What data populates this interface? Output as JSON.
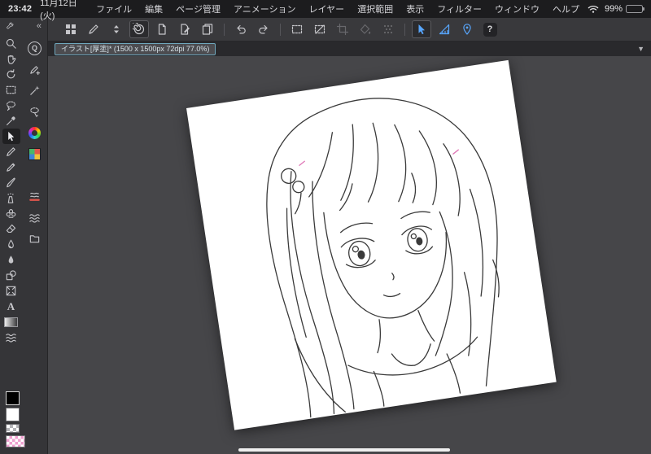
{
  "status_bar": {
    "time": "23:42",
    "date": "11月12日(火)",
    "battery_percent": "99%"
  },
  "menu_bar": {
    "items": [
      {
        "id": "file",
        "label": "ファイル"
      },
      {
        "id": "edit",
        "label": "編集"
      },
      {
        "id": "page-management",
        "label": "ページ管理"
      },
      {
        "id": "animation",
        "label": "アニメーション"
      },
      {
        "id": "layer",
        "label": "レイヤー"
      },
      {
        "id": "selection",
        "label": "選択範囲"
      },
      {
        "id": "view",
        "label": "表示"
      },
      {
        "id": "filter",
        "label": "フィルター"
      },
      {
        "id": "window",
        "label": "ウィンドウ"
      },
      {
        "id": "help",
        "label": "ヘルプ"
      }
    ]
  },
  "toolbar": {
    "items": [
      {
        "name": "workspace-grid-button",
        "icon": "grid"
      },
      {
        "name": "share-button",
        "icon": "pen"
      },
      {
        "name": "command-sort-button",
        "icon": "updown"
      },
      {
        "name": "clip-studio-button",
        "icon": "spiral",
        "selected": true
      },
      {
        "name": "new-canvas-button",
        "icon": "page"
      },
      {
        "name": "edit-canvas-button",
        "icon": "page-pen"
      },
      {
        "name": "page-manager-button",
        "icon": "pages"
      },
      {
        "sep": true
      },
      {
        "name": "undo-button",
        "icon": "undo"
      },
      {
        "name": "redo-button",
        "icon": "redo"
      },
      {
        "sep": true
      },
      {
        "name": "select-area-button",
        "icon": "marquee"
      },
      {
        "name": "deselect-button",
        "icon": "deselect"
      },
      {
        "name": "crop-button",
        "icon": "crop",
        "disabled": true
      },
      {
        "name": "fill-button",
        "icon": "fill",
        "disabled": true
      },
      {
        "name": "screentone-button",
        "icon": "tone",
        "disabled": true
      },
      {
        "sep": true
      },
      {
        "name": "operation-cursor-button",
        "icon": "cursor",
        "accent": true,
        "selected": true
      },
      {
        "name": "ruler-button",
        "icon": "ruler",
        "accent": true
      },
      {
        "name": "reference-button",
        "icon": "pin",
        "accent": true
      },
      {
        "name": "help-button",
        "icon": "help"
      }
    ]
  },
  "document_tab": {
    "label": "イラスト[厚塗]* (1500 x 1500px 72dpi 77.0%)"
  },
  "tool_sidebar": {
    "header": [
      {
        "name": "palette-settings-button",
        "icon": "wrench"
      },
      {
        "name": "collapse-sidebar-button",
        "icon": "chevrons"
      }
    ],
    "primary_tools": [
      {
        "name": "zoom-tool",
        "icon": "magnifier"
      },
      {
        "name": "move-tool",
        "icon": "hand"
      },
      {
        "name": "rotate-canvas-tool",
        "icon": "rotate"
      },
      {
        "name": "selection-tool",
        "icon": "marquee"
      },
      {
        "name": "lasso-tool",
        "icon": "lasso"
      },
      {
        "name": "eyedropper-tool",
        "icon": "dropper"
      },
      {
        "name": "operation-tool",
        "icon": "cursor",
        "selected": true
      },
      {
        "name": "pen-tool",
        "icon": "pen"
      },
      {
        "name": "pencil-tool",
        "icon": "pencil"
      },
      {
        "name": "brush-tool",
        "icon": "brush"
      },
      {
        "name": "airbrush-tool",
        "icon": "spray"
      },
      {
        "name": "decoration-tool",
        "icon": "stamp"
      },
      {
        "name": "eraser-tool",
        "icon": "eraser"
      },
      {
        "name": "blend-tool",
        "icon": "blend"
      },
      {
        "name": "liquify-tool",
        "icon": "droplet"
      },
      {
        "name": "figure-tool",
        "icon": "figure"
      },
      {
        "name": "frame-border-tool",
        "icon": "frame"
      },
      {
        "name": "text-tool",
        "icon": "text"
      },
      {
        "name": "gradient-tool",
        "icon": "gradient"
      },
      {
        "name": "line-correction-tool",
        "icon": "wave"
      }
    ],
    "panel_tools": [
      {
        "name": "quick-access-panel",
        "icon": "qbadge"
      },
      {
        "name": "sub-tool-panel",
        "icon": "penplus"
      },
      {
        "name": "auto-select-panel",
        "icon": "wand"
      },
      {
        "name": "selection-pen-panel",
        "icon": "lassopen"
      },
      {
        "name": "color-wheel-panel",
        "icon": "colorwheel"
      },
      {
        "name": "color-set-panel",
        "icon": "colorset"
      },
      {
        "name": "color-slider-panel",
        "icon": "colorslider"
      },
      {
        "name": "approximate-color-panel",
        "icon": "redline"
      },
      {
        "name": "tone-panel",
        "icon": "wave"
      },
      {
        "name": "material-panel",
        "icon": "folder"
      }
    ],
    "colors": {
      "foreground": "#000000",
      "background": "#ffffff",
      "history_pink": "#f0a0d0"
    }
  },
  "accent": {
    "selection_blue": "#58a7ff"
  }
}
